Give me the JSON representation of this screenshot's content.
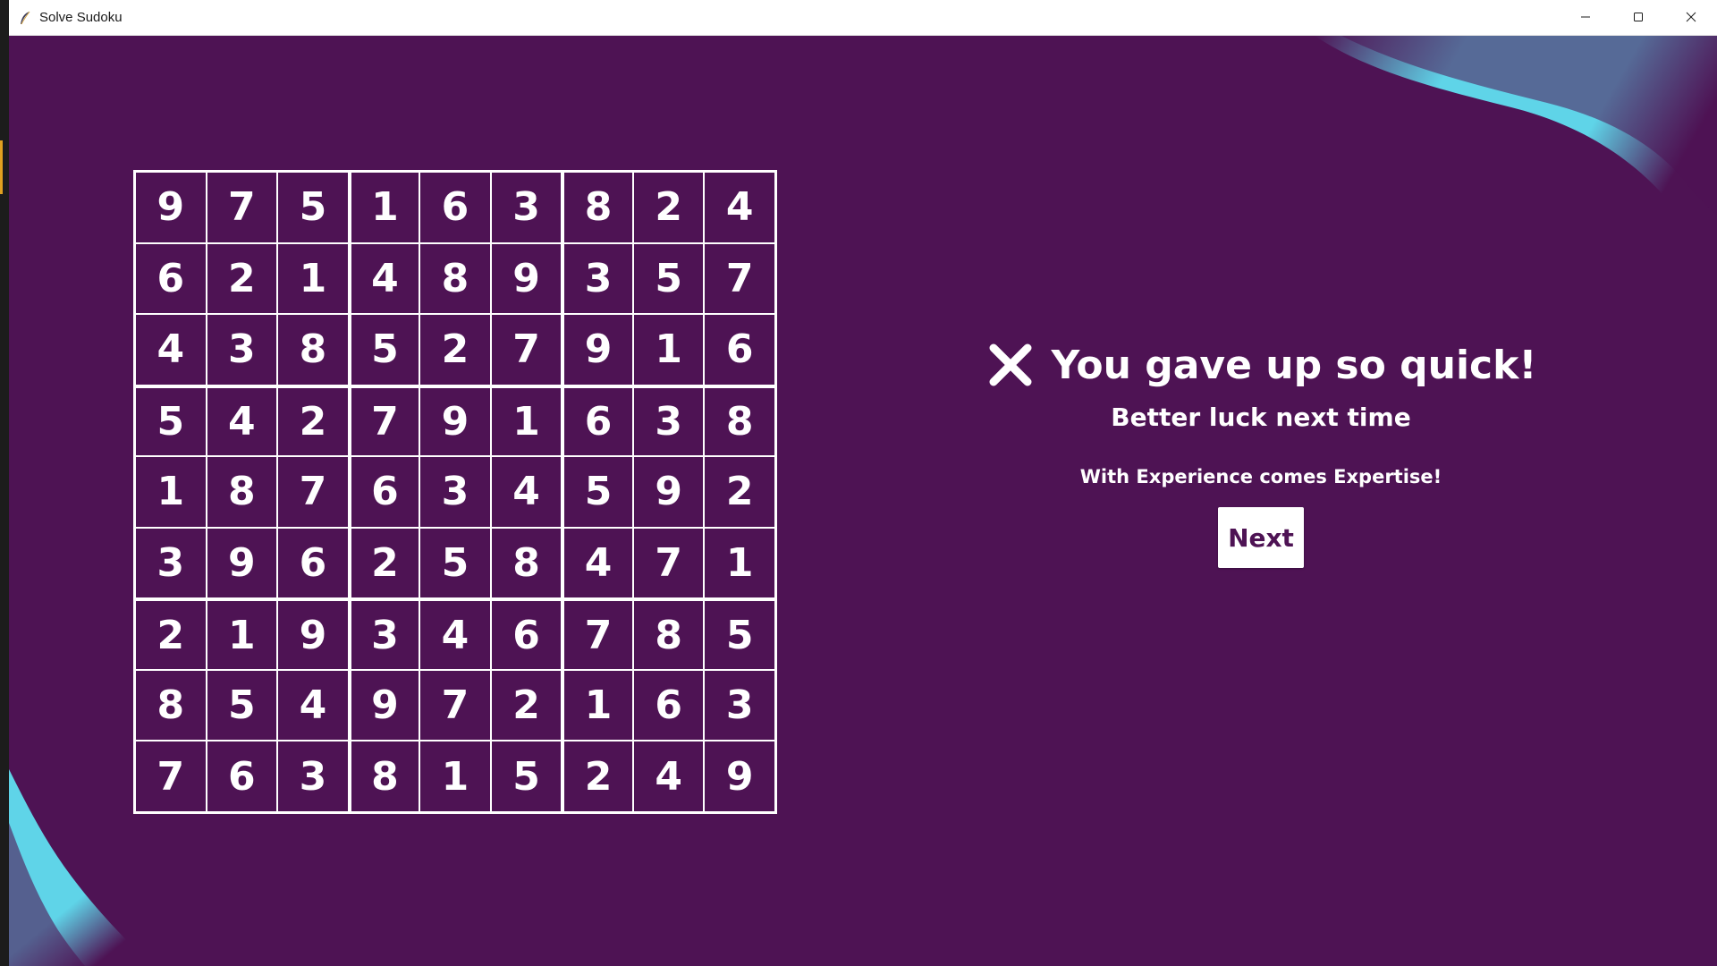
{
  "window": {
    "title": "Solve Sudoku",
    "app_icon": "feather-icon",
    "controls": [
      "minimize-icon",
      "maximize-icon",
      "close-icon"
    ]
  },
  "colors": {
    "background": "#4e1354",
    "accent_gradient": [
      "#5fd4e8",
      "#4e1354"
    ],
    "text": "#ffffff",
    "button_bg": "#ffffff",
    "button_text": "#4e1354"
  },
  "board": [
    [
      "9",
      "7",
      "5",
      "1",
      "6",
      "3",
      "8",
      "2",
      "4"
    ],
    [
      "6",
      "2",
      "1",
      "4",
      "8",
      "9",
      "3",
      "5",
      "7"
    ],
    [
      "4",
      "3",
      "8",
      "5",
      "2",
      "7",
      "9",
      "1",
      "6"
    ],
    [
      "5",
      "4",
      "2",
      "7",
      "9",
      "1",
      "6",
      "3",
      "8"
    ],
    [
      "1",
      "8",
      "7",
      "6",
      "3",
      "4",
      "5",
      "9",
      "2"
    ],
    [
      "3",
      "9",
      "6",
      "2",
      "5",
      "8",
      "4",
      "7",
      "1"
    ],
    [
      "2",
      "1",
      "9",
      "3",
      "4",
      "6",
      "7",
      "8",
      "5"
    ],
    [
      "8",
      "5",
      "4",
      "9",
      "7",
      "2",
      "1",
      "6",
      "3"
    ],
    [
      "7",
      "6",
      "3",
      "8",
      "1",
      "5",
      "2",
      "4",
      "9"
    ]
  ],
  "result": {
    "icon": "x-icon",
    "headline": "You gave up so quick!",
    "subhead": "Better luck next time",
    "tagline": "With Experience comes Expertise!",
    "next_label": "Next"
  }
}
